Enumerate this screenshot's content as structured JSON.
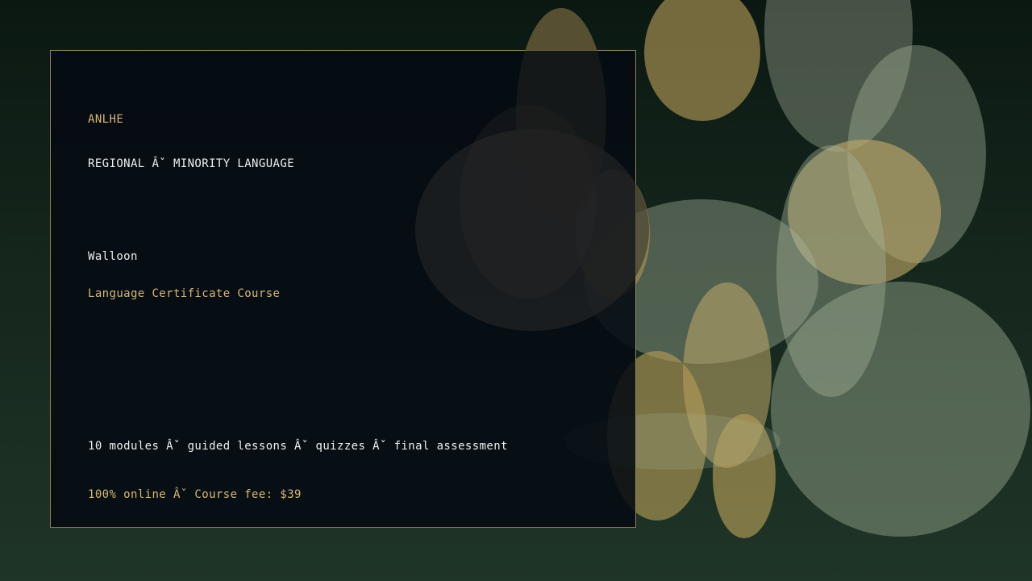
{
  "brand": "ANLHE",
  "category": "REGIONAL Âˇ MINORITY LANGUAGE",
  "language_name": "Walloon",
  "course_title": "Language Certificate Course",
  "features_line": "10 modules Âˇ guided lessons Âˇ quizzes Âˇ final assessment",
  "price_line": "100% online Âˇ Course fee: $39",
  "colors": {
    "accent_gold": "#d8b676",
    "bokeh_gold": "#b69d58",
    "bokeh_sage": "#a8b49c",
    "card_border": "#8f7f52",
    "card_background": "#050a12",
    "background_top": "#0b1812",
    "background_bottom": "#1f3527"
  }
}
